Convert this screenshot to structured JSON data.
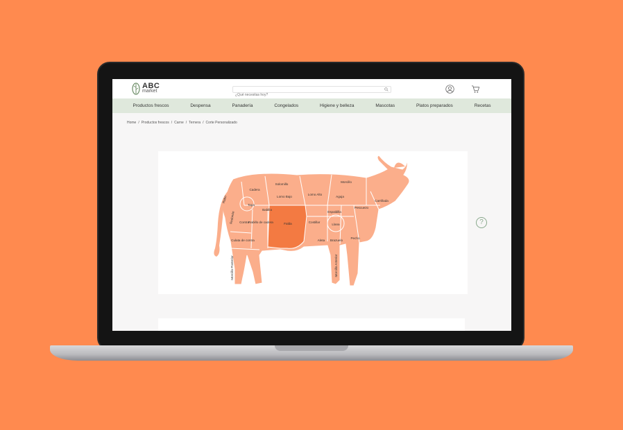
{
  "brand": {
    "name": "ABC",
    "sub": "market"
  },
  "search": {
    "placeholder": "¿Qué necesitas hoy?"
  },
  "nav": {
    "items": [
      "Productos frescos",
      "Despensa",
      "Panadería",
      "Congelados",
      "Higiene y belleza",
      "Mascotas",
      "Platos preparados",
      "Recetas"
    ]
  },
  "breadcrumb": [
    "Home",
    "Productos frescos",
    "Carne",
    "Ternera",
    "Corte Personalizado"
  ],
  "cuts": {
    "selected": "Falda",
    "labels": {
      "rabo": "Rabo",
      "cadera": "Cadera",
      "solomillo": "Solomillo",
      "lomo_bajo": "Lomo Bajo",
      "lomo_alto": "Lomo Alto",
      "morcillo_top": "Morcillo",
      "aguja": "Aguja",
      "carrillada": "Carrillada",
      "tapa": "Tapa",
      "babilla": "Babilla",
      "redondo": "Redondo",
      "espaldilla": "Espaldilla",
      "pescuezo": "Pescuezo",
      "contra": "Contra",
      "rabillo": "Rabillo de cadera",
      "falda": "Falda",
      "costillar": "Costillar",
      "llana": "Llana",
      "culata": "Culata de contra",
      "aleta": "Aleta",
      "brazuelo": "Brazuelo",
      "pecho": "Pecho",
      "morcillo_post": "Morcillo Posterior",
      "morcillo_ant": "Morcillo Anterior"
    }
  },
  "help": {
    "label": "?"
  },
  "colors": {
    "background": "#FF8A4F",
    "cut": "#FBAE8B",
    "selected": "#F37A42",
    "nav": "#dfe8dc"
  }
}
